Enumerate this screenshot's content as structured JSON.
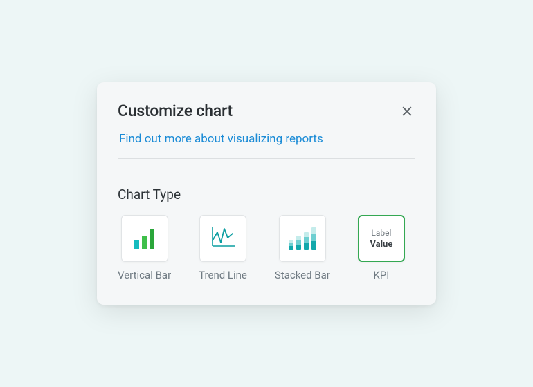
{
  "dialog": {
    "title": "Customize chart",
    "help_link": "Find out more about visualizing reports",
    "section_title": "Chart Type",
    "options": [
      {
        "label": "Vertical Bar"
      },
      {
        "label": "Trend Line"
      },
      {
        "label": "Stacked Bar"
      },
      {
        "label": "KPI"
      }
    ],
    "kpi_tile": {
      "label_text": "Label",
      "value_text": "Value"
    },
    "selected_index": 3
  }
}
